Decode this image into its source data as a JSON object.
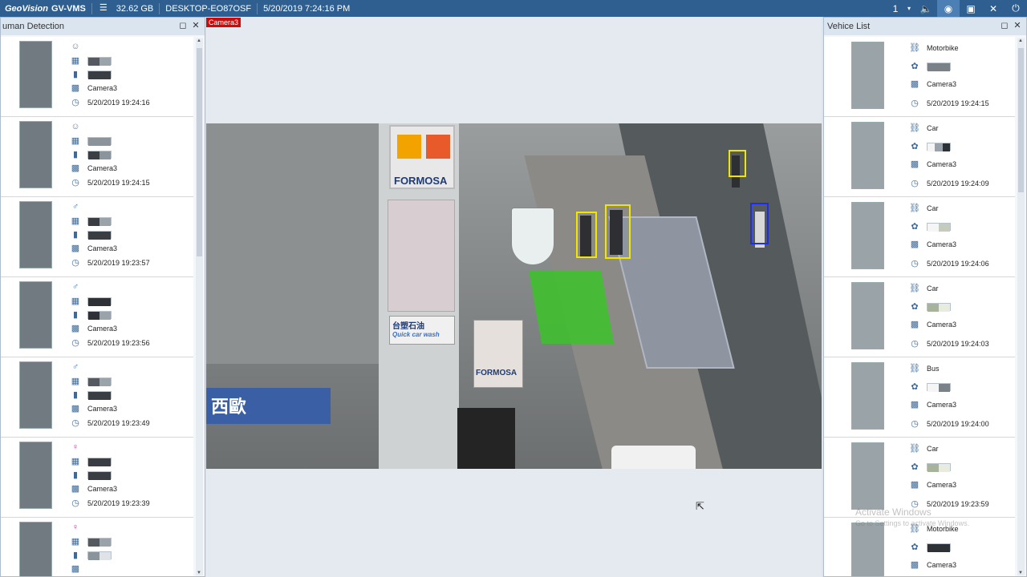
{
  "topbar": {
    "brand": "GeoVision",
    "app": "GV-VMS",
    "storage": "32.62 GB",
    "host": "DESKTOP-EO87OSF",
    "datetime": "5/20/2019 7:24:16 PM",
    "page": "1",
    "colors": {
      "bar": "#2f5f90",
      "active": "#4c80b4"
    }
  },
  "left_panel": {
    "title": "uman Detection",
    "items": [
      {
        "time": "5/20/2019 19:24:16",
        "camera": "Camera3",
        "gender_icon": "group-icon",
        "top_colors": [
          "#555a60",
          "#9aa2aa"
        ],
        "bottom_colors": [
          "#3a3d42"
        ]
      },
      {
        "time": "5/20/2019 19:24:15",
        "camera": "Camera3",
        "gender_icon": "group-icon",
        "top_colors": [
          "#8b939b"
        ],
        "bottom_colors": [
          "#3a3d42",
          "#8b939b"
        ]
      },
      {
        "time": "5/20/2019 19:23:57",
        "camera": "Camera3",
        "gender_icon": "male-icon",
        "top_colors": [
          "#3a3d42",
          "#9aa2aa"
        ],
        "bottom_colors": [
          "#3a3d42"
        ]
      },
      {
        "time": "5/20/2019 19:23:56",
        "camera": "Camera3",
        "gender_icon": "male-icon",
        "top_colors": [
          "#2e3136"
        ],
        "bottom_colors": [
          "#2e3136",
          "#9aa2aa"
        ]
      },
      {
        "time": "5/20/2019 19:23:49",
        "camera": "Camera3",
        "gender_icon": "male-icon",
        "top_colors": [
          "#555a60",
          "#9aa2aa"
        ],
        "bottom_colors": [
          "#3a3d42"
        ]
      },
      {
        "time": "5/20/2019 19:23:39",
        "camera": "Camera3",
        "gender_icon": "female-icon",
        "top_colors": [
          "#3a3d42"
        ],
        "bottom_colors": [
          "#3a3d42"
        ]
      },
      {
        "time": "",
        "camera": "",
        "gender_icon": "female-icon",
        "top_colors": [
          "#555a60",
          "#9aa2aa"
        ],
        "bottom_colors": [
          "#8b939b",
          "#dfe3e7"
        ]
      }
    ]
  },
  "center": {
    "camera_label": "Camera3",
    "sign_text": "FORMOSA",
    "sign_text2": "FORMOSA",
    "banner_text": "西歐",
    "overlay_text": "台塑石油",
    "overlay_sub": "Quick car wash"
  },
  "right_panel": {
    "title": "Vehice List",
    "items": [
      {
        "type": "Motorbike",
        "camera": "Camera3",
        "time": "5/20/2019 19:24:15",
        "colors": [
          "#7a8288"
        ]
      },
      {
        "type": "Car",
        "camera": "Camera3",
        "time": "5/20/2019 19:24:09",
        "colors": [
          "#f5f5f5",
          "#9aa2aa",
          "#2e3136"
        ]
      },
      {
        "type": "Car",
        "camera": "Camera3",
        "time": "5/20/2019 19:24:06",
        "colors": [
          "#f5f5f5",
          "#c5cbbd"
        ]
      },
      {
        "type": "Car",
        "camera": "Camera3",
        "time": "5/20/2019 19:24:03",
        "colors": [
          "#a7b39a",
          "#e8ecdf"
        ]
      },
      {
        "type": "Bus",
        "camera": "Camera3",
        "time": "5/20/2019 19:24:00",
        "colors": [
          "#f5f5f5",
          "#7a8288"
        ]
      },
      {
        "type": "Car",
        "camera": "Camera3",
        "time": "5/20/2019 19:23:59",
        "colors": [
          "#a7b39a",
          "#e8ecdf"
        ]
      },
      {
        "type": "Motorbike",
        "camera": "Camera3",
        "time": "",
        "colors": [
          "#2e3136"
        ]
      }
    ]
  },
  "watermark": {
    "line1": "Activate Windows",
    "line2": "Go to Settings to activate Windows."
  }
}
